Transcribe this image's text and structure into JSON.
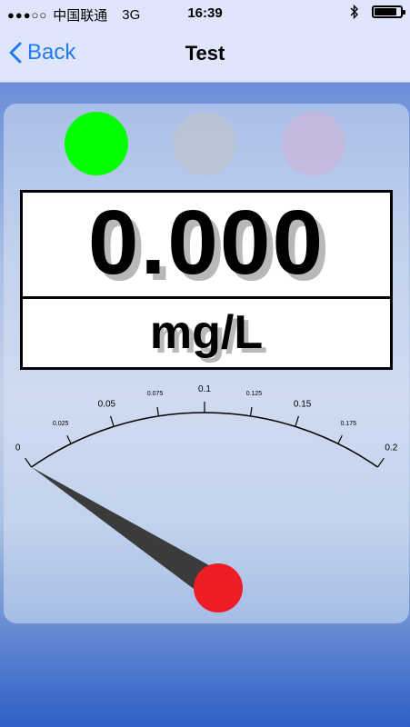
{
  "status_bar": {
    "carrier": "中国联通",
    "network": "3G",
    "time": "16:39",
    "battery_level": 0.85
  },
  "nav": {
    "back_label": "Back",
    "title": "Test"
  },
  "indicators": [
    {
      "name": "green",
      "color": "#00ff00",
      "active": true
    },
    {
      "name": "gray",
      "color": "#bcc4cf",
      "active": false
    },
    {
      "name": "pink",
      "color": "#c9b6d9",
      "active": false
    }
  ],
  "reading": {
    "value": "0.000",
    "unit": "mg/L"
  },
  "gauge": {
    "min": 0,
    "max": 0.2,
    "current_value": 0,
    "tick_labels": [
      "0",
      "0.025",
      "0.05",
      "0.075",
      "0.1",
      "0.125",
      "0.15",
      "0.175",
      "0.2"
    ],
    "needle_color": "#3b3b3b",
    "hub_color": "#ee1c24"
  }
}
